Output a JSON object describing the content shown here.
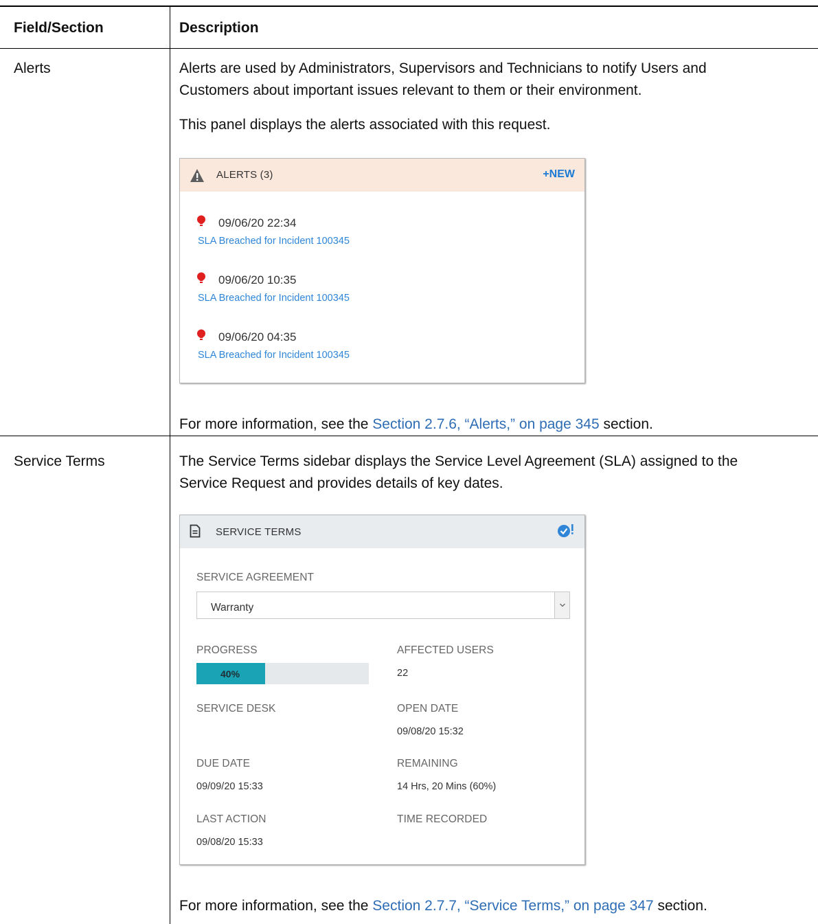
{
  "table": {
    "col1_header": "Field/Section",
    "col2_header": "Description"
  },
  "alerts_row": {
    "field": "Alerts",
    "desc_line1": "Alerts are used by Administrators, Supervisors and Technicians to notify Users and",
    "desc_line2": "Customers about important issues relevant to them or their environment.",
    "desc_para2": "This panel displays the alerts associated with this request.",
    "more_prefix": "For more information, see the ",
    "more_link": "Section 2.7.6, “Alerts,” on page 345",
    "more_suffix": " section."
  },
  "alerts_panel": {
    "title": "ALERTS (3)",
    "new_button": "+NEW",
    "header_bg": "#fbe8dc",
    "items": [
      {
        "date": "09/06/20 22:34",
        "link": "SLA Breached for Incident 100345"
      },
      {
        "date": "09/06/20 10:35",
        "link": "SLA Breached for Incident 100345"
      },
      {
        "date": "09/06/20 04:35",
        "link": "SLA Breached for Incident 100345"
      }
    ]
  },
  "service_row": {
    "field": "Service Terms",
    "desc_line1": "The Service Terms sidebar displays the Service Level Agreement (SLA) assigned to the",
    "desc_line2": "Service Request and provides details of key dates.",
    "more_prefix": "For more information, see the ",
    "more_link": "Section 2.7.7, “Service Terms,” on page 347",
    "more_suffix": " section."
  },
  "service_panel": {
    "title": "SERVICE TERMS",
    "header_bg": "#e9ecef",
    "agreement_label": "SERVICE AGREEMENT",
    "agreement_value": "Warranty",
    "progress_label": "PROGRESS",
    "progress_text": "40%",
    "progress_fraction": 0.4,
    "progress_color": "#1aa3b5",
    "affected_users_label": "AFFECTED USERS",
    "affected_users_value": "22",
    "service_desk_label": "SERVICE DESK",
    "open_date_label": "OPEN DATE",
    "open_date_value": "09/08/20 15:32",
    "due_date_label": "DUE DATE",
    "due_date_value": "09/09/20 15:33",
    "remaining_label": "REMAINING",
    "remaining_value": "14 Hrs, 20 Mins (60%)",
    "last_action_label": "LAST ACTION",
    "last_action_value": "09/08/20 15:33",
    "time_recorded_label": "TIME RECORDED"
  },
  "colors": {
    "link": "#2e6db4",
    "panel_link": "#2f86d8",
    "new_button": "#1a7ad4",
    "alert_bulb": "#e01f1f",
    "check_badge": "#2f86d8"
  },
  "icons": [
    "warning-triangle-icon",
    "lightbulb-icon",
    "document-icon",
    "check-circle-icon",
    "chevron-down-icon"
  ]
}
